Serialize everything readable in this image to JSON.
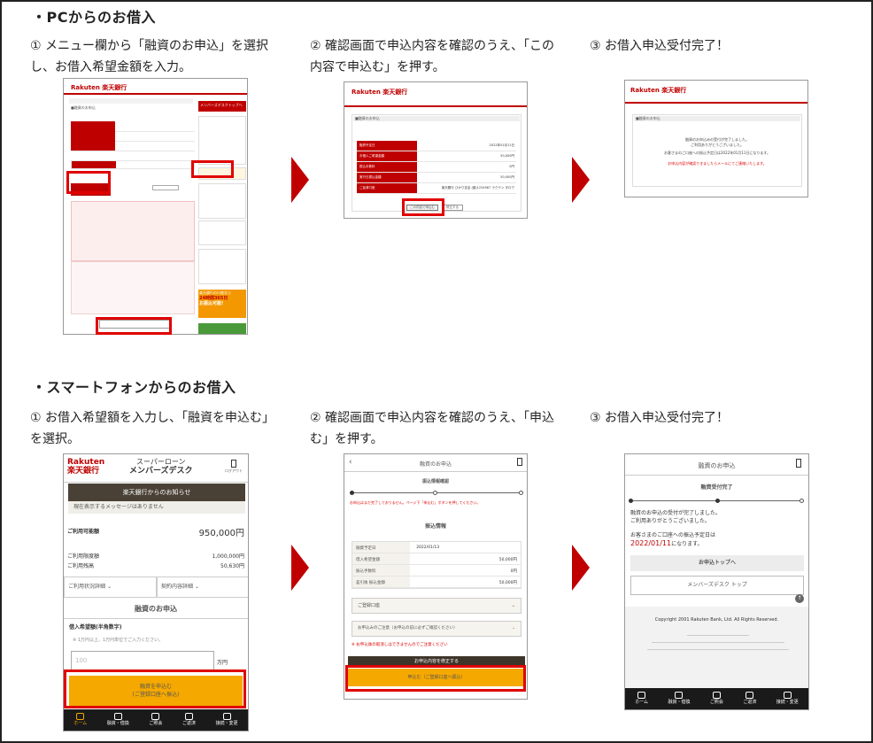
{
  "pc": {
    "title": "・PCからのお借入",
    "steps": [
      "① メニュー欄から「融資のお申込」を選択し、お借入希望金額を入力。",
      "② 確認画面で申込内容を確認のうえ、「この内容で申込む」を押す。",
      "③ お借入申込受付完了！"
    ],
    "shot2": {
      "logo": "Rakuten 楽天銀行",
      "heading": "■融資のお申込",
      "rows": [
        "融資予定日",
        "お借入ご希望金額",
        "振込手数料",
        "実行日振込金額",
        "ご返済口座"
      ],
      "values": [
        "2022年01月11日",
        "50,000円",
        "0円",
        "50,000円",
        "楽天銀行 ひかり支店 (普)1234567 ラクテン タロウ"
      ],
      "button": "この内容で申込む",
      "back": "修正する"
    },
    "shot3": {
      "logo": "Rakuten 楽天銀行",
      "heading": "■融資のお申込",
      "msg1": "融資のお申込みの受付が完了しました。",
      "msg2": "ご利用ありがとうございました。",
      "msg3": "お客さまのご口座への振込予定日は2022年01月11日になります。",
      "msg4": "お申込内容が確認できましたらメールにてご連絡いたします。"
    },
    "shot1": {
      "logo": "Rakuten 楽天銀行",
      "heading": "■融資のお申込",
      "side_button": "メンバーズデスクトップへ",
      "banner_line1": "楽天銀行の口座なら",
      "banner_line2": "24時間365日",
      "banner_line3": "お振込可能!"
    }
  },
  "sp": {
    "title": "・スマートフォンからのお借入",
    "steps": [
      "① お借入希望額を入力し、「融資を申込む」を選択。",
      "② 確認画面で申込内容を確認のうえ、「申込む」を押す。",
      "③ お借入申込受付完了！"
    ],
    "shot1": {
      "logo_en": "Rakuten",
      "logo_jp": "楽天銀行",
      "service": "スーパーローン",
      "service2": "メンバーズデスク",
      "logout": "ログアウト",
      "notice_title": "楽天銀行からのお知らせ",
      "notice_text": "現在表示するメッセージはありません",
      "available_label": "ご利用可能額",
      "available_value": "950,000円",
      "limit_label": "ご利用限度額",
      "limit_value": "1,000,000円",
      "balance_label": "ご利用残高",
      "balance_value": "50,630円",
      "tab1": "ご利用状況詳細",
      "tab2": "契約内容詳細",
      "section": "融資のお申込",
      "field_label": "借入希望額(半角数字)",
      "field_note": "※ 1万円以上、1万円単位でご入力ください。",
      "field_placeholder": "100",
      "field_unit": "万円",
      "button_line1": "融資を申込む",
      "button_line2": "(ご登録口座へ振込)"
    },
    "shot2": {
      "title": "融資のお申込",
      "subtitle": "振込情報確認",
      "warn": "お申込はまだ完了しておりません。ページ下「申込む」ボタンを押してください。",
      "section": "振込情報",
      "rows": [
        "融資予定日",
        "借入希望金額",
        "振込手数料",
        "差引後 振込金額"
      ],
      "values": [
        "2022/01/13",
        "50,000円",
        "0円",
        "50,000円"
      ],
      "acc1": "ご登録口座",
      "acc2": "お申込みのご注意（お申込の前に必ずご確認ください）",
      "note": "※ お申込後の取消しはできませんのでご注意ください",
      "confirm": "お申込内容を修正する",
      "submit": "申込む（ご登録口座へ振込）"
    },
    "shot3": {
      "title": "融資のお申込",
      "subtitle": "融資受付完了",
      "msg1": "融資のお申込の受付が完了しました。",
      "msg2": "ご利用ありがとうございました。",
      "msg3": "お客さまのご口座への振込予定日は",
      "date": "2022/01/11",
      "date_suffix": "になります。",
      "btn1": "お申込トップへ",
      "btn2": "メンバーズデスク トップ",
      "copyright": "Copyright 2001 Rakuten Bank, Ltd. All Rights Reserved."
    },
    "nav": [
      "ホーム",
      "融資・借換",
      "ご照会",
      "ご返済",
      "接続・変更"
    ]
  }
}
